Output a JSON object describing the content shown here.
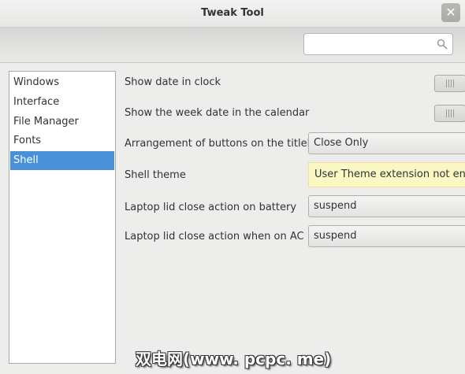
{
  "window": {
    "title": "Tweak Tool",
    "close_glyph": "✕"
  },
  "search": {
    "value": "",
    "placeholder": "",
    "icon": "search-icon"
  },
  "sidebar": {
    "items": [
      {
        "label": "Windows",
        "selected": false
      },
      {
        "label": "Interface",
        "selected": false
      },
      {
        "label": "File Manager",
        "selected": false
      },
      {
        "label": "Fonts",
        "selected": false
      },
      {
        "label": "Shell",
        "selected": true
      }
    ]
  },
  "settings": {
    "show_date_in_clock": {
      "label": "Show date in clock",
      "state": "off"
    },
    "show_week_date": {
      "label": "Show the week date in the calendar",
      "state": "off"
    },
    "titlebar_buttons": {
      "label": "Arrangement of buttons on the titlebar",
      "value": "Close Only"
    },
    "shell_theme": {
      "label": "Shell theme",
      "message": "User Theme extension not enabled"
    },
    "lid_battery": {
      "label": "Laptop lid close action on battery",
      "value": "suspend"
    },
    "lid_ac": {
      "label": "Laptop lid close action when on AC",
      "value": "suspend"
    }
  },
  "watermark": {
    "text": "双电网(www. pcpc. me)"
  },
  "colors": {
    "selection": "#4a90d9",
    "info_background": "#fcf8c3",
    "window_background": "#ededec"
  }
}
